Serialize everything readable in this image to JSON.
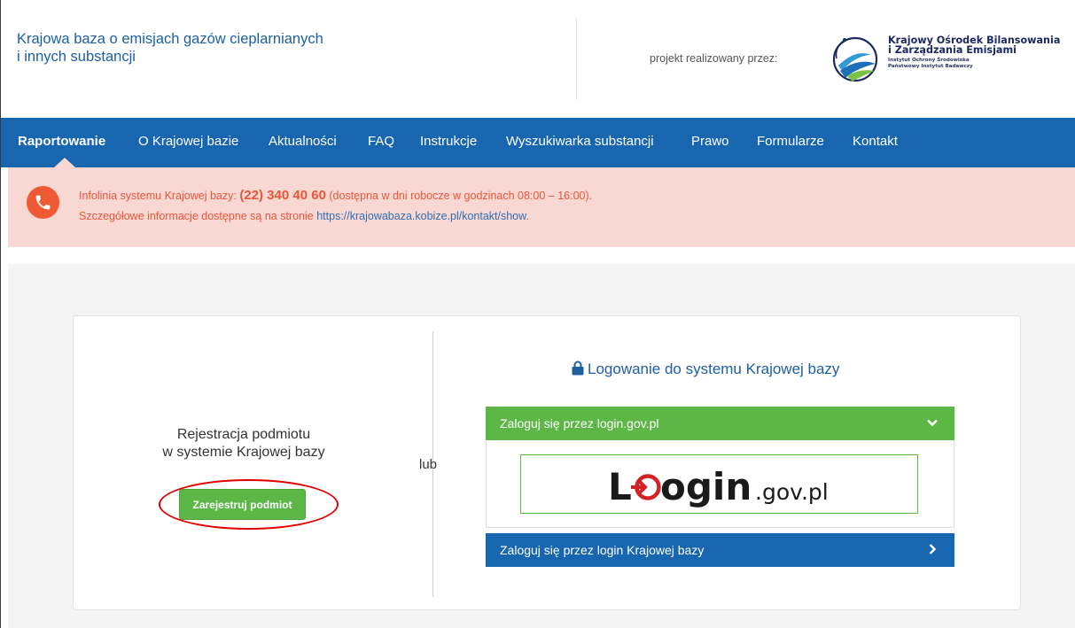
{
  "header": {
    "site_title_line1": "Krajowa baza o emisjach gazów cieplarnianych",
    "site_title_line2": "i innych substancji",
    "project_by": "projekt realizowany przez:",
    "org_name_line1": "Krajowy Ośrodek Bilansowania",
    "org_name_line2": "i Zarządzania Emisjami",
    "org_sub_line1": "Instytut Ochrony Środowiska",
    "org_sub_line2": "Państwowy Instytut Badawczy"
  },
  "nav": {
    "items": [
      {
        "label": "Raportowanie",
        "active": true
      },
      {
        "label": "O Krajowej bazie"
      },
      {
        "label": "Aktualności"
      },
      {
        "label": "FAQ"
      },
      {
        "label": "Instrukcje"
      },
      {
        "label": "Wyszukiwarka substancji"
      },
      {
        "label": "Prawo"
      },
      {
        "label": "Formularze"
      },
      {
        "label": "Kontakt"
      }
    ]
  },
  "info": {
    "line1_prefix": "Infolinia systemu Krajowej bazy: ",
    "phone": "(22) 340 40 60",
    "line1_suffix": " (dostępna w dni robocze w godzinach 08:00 – 16:00).",
    "line2_prefix": "Szczegółowe informacje dostępne są na stronie ",
    "link": "https://krajowabaza.kobize.pl/kontakt/show",
    "line2_suffix": "."
  },
  "register": {
    "title_line1": "Rejestracja podmiotu",
    "title_line2": "w systemie Krajowej bazy",
    "button": "Zarejestruj podmiot"
  },
  "separator": "lub",
  "login": {
    "title": "Logowanie do systemu Krajowej bazy",
    "gov_panel_label": "Zaloguj się przez login.gov.pl",
    "gov_logo_main": "ogin",
    "gov_logo_suffix": ".gov.pl",
    "local_panel_label": "Zaloguj się przez login Krajowej bazy"
  },
  "colors": {
    "nav_bg": "#1866b0",
    "accent_green": "#5cb746",
    "banner_bg": "#f9d8d3",
    "banner_text": "#e8563a",
    "annotation_red": "#e00000"
  }
}
